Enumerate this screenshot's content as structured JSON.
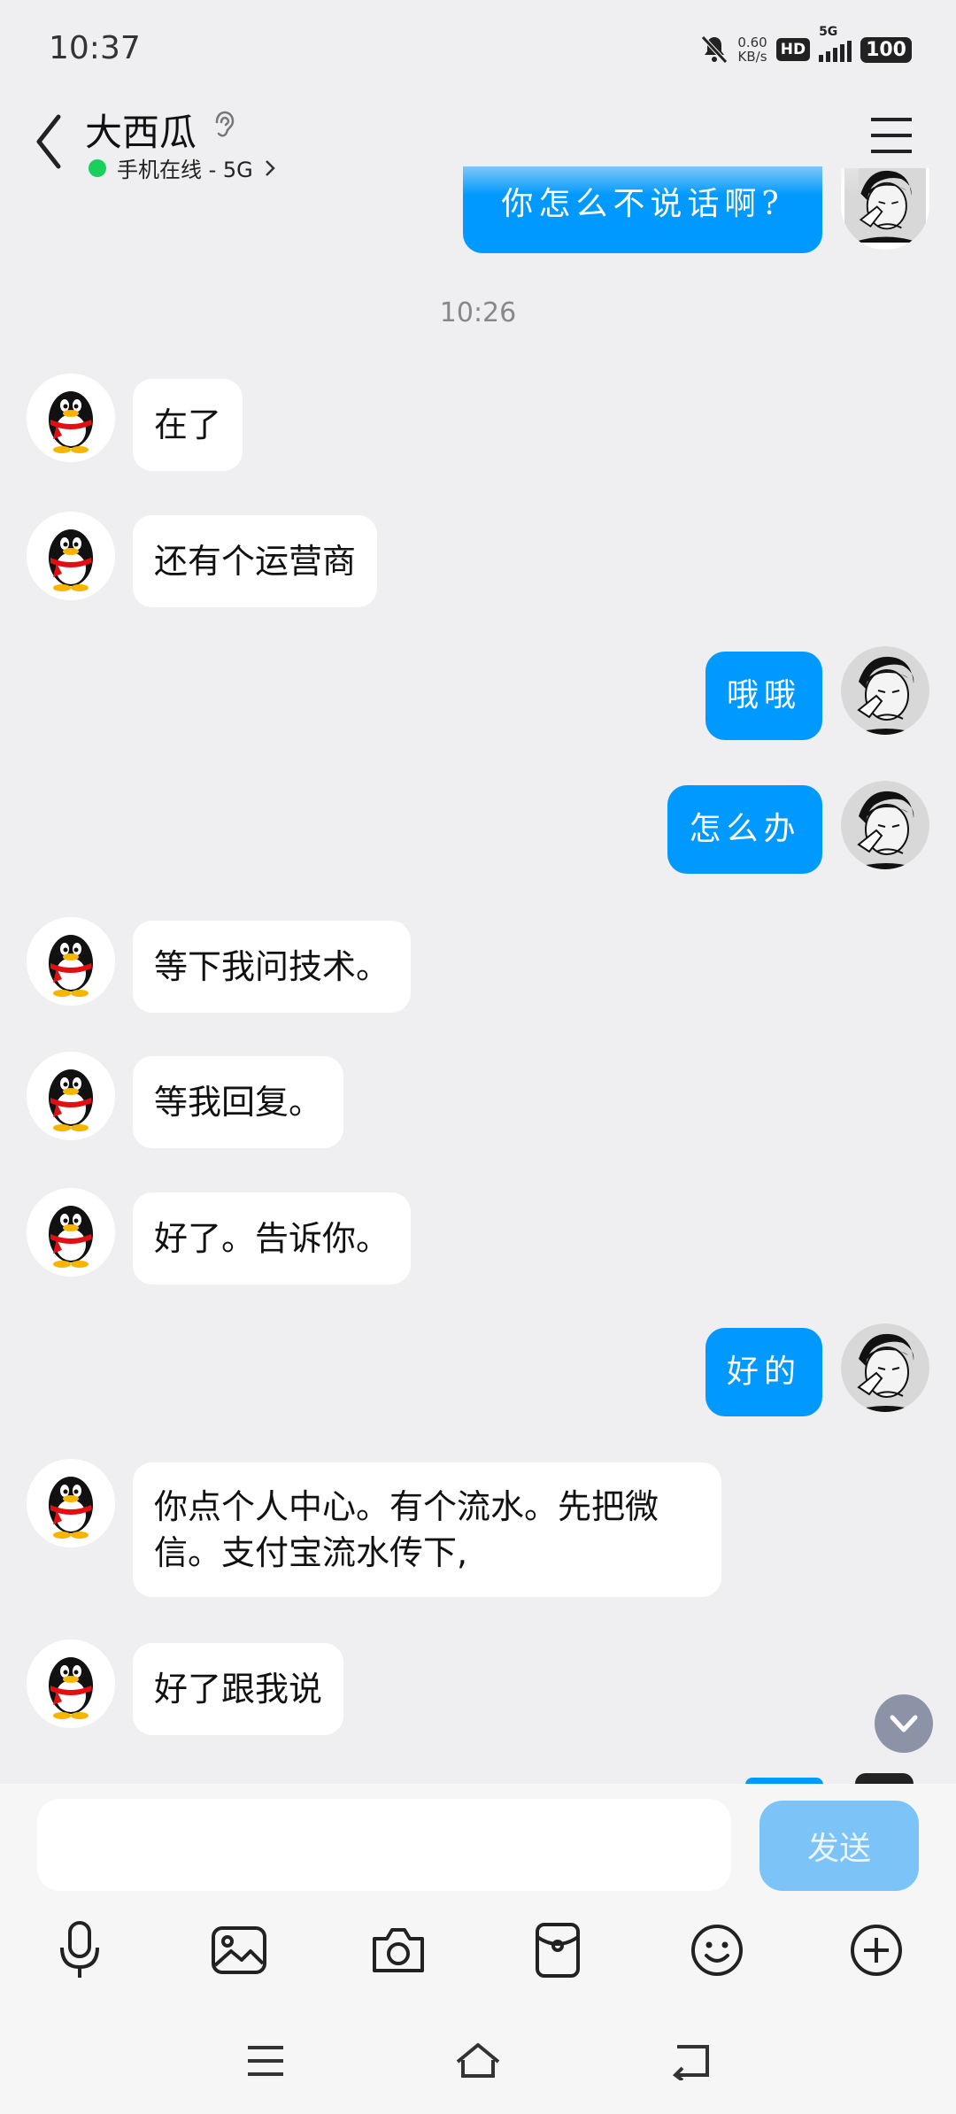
{
  "status_bar": {
    "time": "10:37",
    "net_speed": "0.60",
    "net_unit": "KB/s",
    "hd_label": "HD",
    "network_type": "5G",
    "battery": "100"
  },
  "header": {
    "contact_name": "大西瓜",
    "presence": "手机在线 - 5G",
    "presence_color": "#19d05d"
  },
  "messages": [
    {
      "side": "out",
      "text": "你怎么不说话啊?"
    },
    {
      "side": "in",
      "text": "在了"
    },
    {
      "side": "in",
      "text": "还有个运营商"
    },
    {
      "side": "out",
      "text": "哦哦"
    },
    {
      "side": "out",
      "text": "怎么办"
    },
    {
      "side": "in",
      "text": "等下我问技术。"
    },
    {
      "side": "in",
      "text": "等我回复。"
    },
    {
      "side": "in",
      "text": "好了。告诉你。"
    },
    {
      "side": "out",
      "text": "好的"
    },
    {
      "side": "in",
      "text": "你点个人中心。有个流水。先把微信。支付宝流水传下,"
    },
    {
      "side": "in",
      "text": "好了跟我说"
    }
  ],
  "timestamp": "10:26",
  "composer": {
    "input_value": "",
    "send_label": "发送"
  },
  "toolbar_icons": [
    "microphone-icon",
    "image-icon",
    "camera-icon",
    "red-packet-icon",
    "emoji-icon",
    "plus-icon"
  ],
  "colors": {
    "outgoing_bubble": "#0099ff",
    "incoming_bubble": "#ffffff",
    "background": "#efeff1",
    "send_button": "#7cc4f8"
  }
}
